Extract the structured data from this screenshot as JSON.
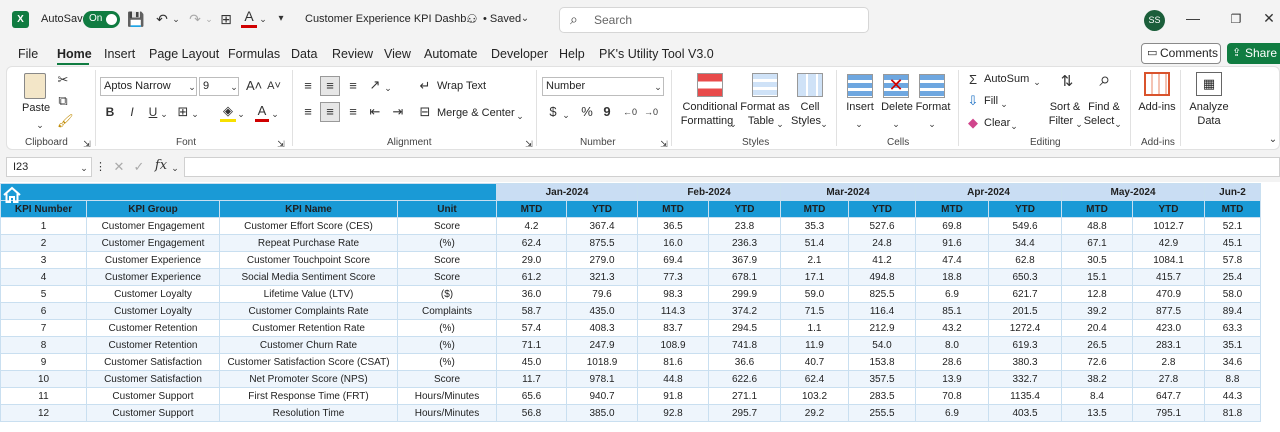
{
  "titlebar": {
    "autosave_label": "AutoSave",
    "autosave_state": "On",
    "doc_title": "Customer Experience KPI Dashb...",
    "saved_status": "• Saved",
    "search_placeholder": "Search",
    "avatar_initials": "SS",
    "excel_logo_letter": "X"
  },
  "menu": {
    "tabs": [
      "File",
      "Home",
      "Insert",
      "Page Layout",
      "Formulas",
      "Data",
      "Review",
      "View",
      "Automate",
      "Developer",
      "Help",
      "PK's Utility Tool V3.0"
    ],
    "comments_label": "Comments",
    "share_label": "Share"
  },
  "ribbon": {
    "clipboard": {
      "paste": "Paste",
      "label": "Clipboard"
    },
    "font": {
      "name": "Aptos Narrow",
      "size": "9",
      "label": "Font",
      "bold": "B",
      "italic": "I",
      "underline": "U"
    },
    "alignment": {
      "wrap": "Wrap Text",
      "merge": "Merge & Center",
      "label": "Alignment"
    },
    "number": {
      "format": "Number",
      "label": "Number",
      "currency": "$",
      "percent": "%",
      "comma": "9"
    },
    "styles": {
      "conditional_1": "Conditional",
      "conditional_2": "Formatting",
      "format_table_1": "Format as",
      "format_table_2": "Table",
      "cell_styles_1": "Cell",
      "cell_styles_2": "Styles",
      "label": "Styles"
    },
    "cells": {
      "insert": "Insert",
      "delete": "Delete",
      "format": "Format",
      "label": "Cells"
    },
    "editing": {
      "autosum": "AutoSum",
      "fill": "Fill",
      "clear": "Clear",
      "sort_1": "Sort &",
      "sort_2": "Filter",
      "find_1": "Find &",
      "find_2": "Select",
      "label": "Editing"
    },
    "addins": {
      "addins": "Add-ins",
      "label": "Add-ins"
    },
    "analyze": {
      "line1": "Analyze",
      "line2": "Data"
    }
  },
  "formula_bar": {
    "name_box": "I23",
    "fx": "fx",
    "value": ""
  },
  "sheet": {
    "months": [
      "Jan-2024",
      "Feb-2024",
      "Mar-2024",
      "Apr-2024",
      "May-2024",
      "Jun-2"
    ],
    "headers": [
      "KPI Number",
      "KPI Group",
      "KPI Name",
      "Unit"
    ],
    "mtd": "MTD",
    "ytd": "YTD",
    "rows": [
      {
        "num": "1",
        "group": "Customer Engagement",
        "name": "Customer Effort Score (CES)",
        "unit": "Score",
        "vals": [
          "4.2",
          "367.4",
          "36.5",
          "23.8",
          "35.3",
          "527.6",
          "69.8",
          "549.6",
          "48.8",
          "1012.7",
          "52.1"
        ]
      },
      {
        "num": "2",
        "group": "Customer Engagement",
        "name": "Repeat Purchase Rate",
        "unit": "(%)",
        "vals": [
          "62.4",
          "875.5",
          "16.0",
          "236.3",
          "51.4",
          "24.8",
          "91.6",
          "34.4",
          "67.1",
          "42.9",
          "45.1"
        ]
      },
      {
        "num": "3",
        "group": "Customer Experience",
        "name": "Customer Touchpoint Score",
        "unit": "Score",
        "vals": [
          "29.0",
          "279.0",
          "69.4",
          "367.9",
          "2.1",
          "41.2",
          "47.4",
          "62.8",
          "30.5",
          "1084.1",
          "57.8"
        ]
      },
      {
        "num": "4",
        "group": "Customer Experience",
        "name": "Social Media Sentiment Score",
        "unit": "Score",
        "vals": [
          "61.2",
          "321.3",
          "77.3",
          "678.1",
          "17.1",
          "494.8",
          "18.8",
          "650.3",
          "15.1",
          "415.7",
          "25.4"
        ]
      },
      {
        "num": "5",
        "group": "Customer Loyalty",
        "name": "Lifetime Value (LTV)",
        "unit": "($)",
        "vals": [
          "36.0",
          "79.6",
          "98.3",
          "299.9",
          "59.0",
          "825.5",
          "6.9",
          "621.7",
          "12.8",
          "470.9",
          "58.0"
        ]
      },
      {
        "num": "6",
        "group": "Customer Loyalty",
        "name": "Customer Complaints Rate",
        "unit": "Complaints",
        "vals": [
          "58.7",
          "435.0",
          "114.3",
          "374.2",
          "71.5",
          "116.4",
          "85.1",
          "201.5",
          "39.2",
          "877.5",
          "89.4"
        ]
      },
      {
        "num": "7",
        "group": "Customer Retention",
        "name": "Customer Retention Rate",
        "unit": "(%)",
        "vals": [
          "57.4",
          "408.3",
          "83.7",
          "294.5",
          "1.1",
          "212.9",
          "43.2",
          "1272.4",
          "20.4",
          "423.0",
          "63.3"
        ]
      },
      {
        "num": "8",
        "group": "Customer Retention",
        "name": "Customer Churn Rate",
        "unit": "(%)",
        "vals": [
          "71.1",
          "247.9",
          "108.9",
          "741.8",
          "11.9",
          "54.0",
          "8.0",
          "619.3",
          "26.5",
          "283.1",
          "35.1"
        ]
      },
      {
        "num": "9",
        "group": "Customer Satisfaction",
        "name": "Customer Satisfaction Score (CSAT)",
        "unit": "(%)",
        "vals": [
          "45.0",
          "1018.9",
          "81.6",
          "36.6",
          "40.7",
          "153.8",
          "28.6",
          "380.3",
          "72.6",
          "2.8",
          "34.6"
        ]
      },
      {
        "num": "10",
        "group": "Customer Satisfaction",
        "name": "Net Promoter Score (NPS)",
        "unit": "Score",
        "vals": [
          "11.7",
          "978.1",
          "44.8",
          "622.6",
          "62.4",
          "357.5",
          "13.9",
          "332.7",
          "38.2",
          "27.8",
          "8.8"
        ]
      },
      {
        "num": "11",
        "group": "Customer Support",
        "name": "First Response Time (FRT)",
        "unit": "Hours/Minutes",
        "vals": [
          "65.6",
          "940.7",
          "91.8",
          "271.1",
          "103.2",
          "283.5",
          "70.8",
          "1135.4",
          "8.4",
          "647.7",
          "44.3"
        ]
      },
      {
        "num": "12",
        "group": "Customer Support",
        "name": "Resolution Time",
        "unit": "Hours/Minutes",
        "vals": [
          "56.8",
          "385.0",
          "92.8",
          "295.7",
          "29.2",
          "255.5",
          "6.9",
          "403.5",
          "13.5",
          "795.1",
          "81.8"
        ]
      }
    ]
  }
}
